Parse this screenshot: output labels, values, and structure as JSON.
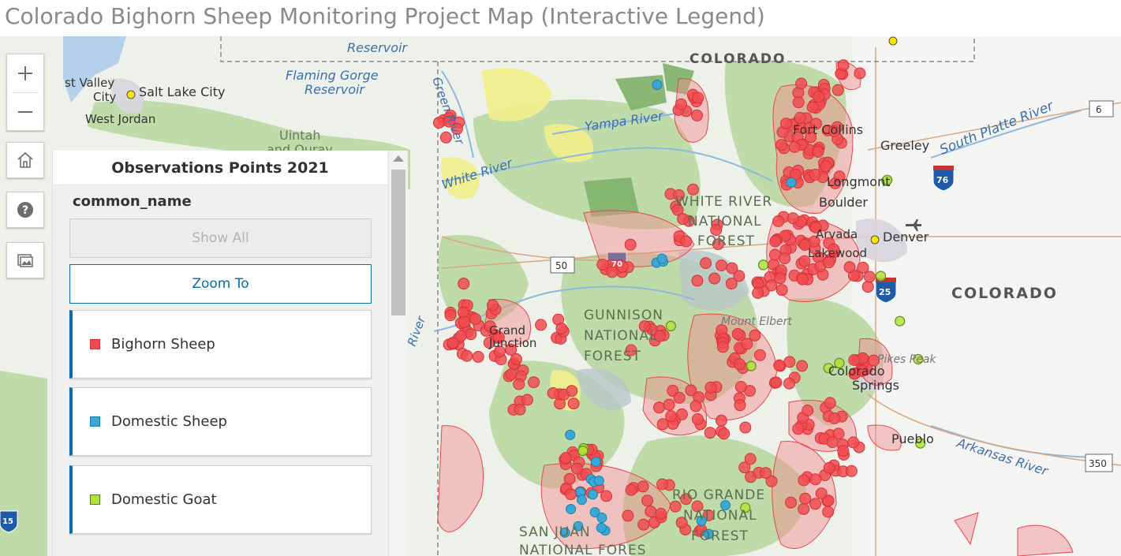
{
  "app": {
    "title": "Colorado Bighorn Sheep Monitoring Project Map (Interactive Legend)"
  },
  "map": {
    "labels": {
      "colorado_top": "COLORADO",
      "colorado_east": "COLORADO",
      "salt_lake_city": "Salt Lake City",
      "west_valley": "st Valley",
      "west_valley2": "City",
      "west_jordan": "West Jordan",
      "flaming_gorge": "Flaming Gorge",
      "reservoir": "Reservoir",
      "flaming_gorge_top": "Reservoir",
      "uintah": "Uintah",
      "and_ouray": "and Ouray",
      "green_river": "Green River",
      "yampa_river": "Yampa River",
      "white_river": "White River",
      "white_river_nf1": "WHITE RIVER",
      "white_river_nf2": "NATIONAL",
      "white_river_nf3": "FOREST",
      "gunnison1": "GUNNISON",
      "gunnison2": "NATIONAL",
      "gunnison3": "FOREST",
      "rio_grande1": "RIO GRANDE",
      "rio_grande2": "NATIONAL",
      "rio_grande3": "FOREST",
      "san_juan1": "SAN JUAN",
      "san_juan2": "NATIONAL FORES",
      "fort_collins": "Fort Collins",
      "greeley": "Greeley",
      "longmont": "Longmont",
      "boulder": "Boulder",
      "arvada": "Arvada",
      "lakewood": "Lakewood",
      "denver": "Denver",
      "colorado_springs1": "Colorado",
      "colorado_springs2": "Springs",
      "pikes_peak": "Pikes Peak",
      "mount_elbert": "Mount Elbert",
      "pueblo": "Pueblo",
      "south_platte": "South Platte River",
      "arkansas": "Arkansas River",
      "grand_junction1": "Grand",
      "grand_junction2": "Junction",
      "river_left": "River",
      "i76": "76",
      "i25": "25",
      "i70": "70",
      "i15": "15",
      "us6": "6",
      "us50": "50",
      "us350": "350"
    },
    "colors": {
      "bighorn": "#f0484d",
      "domestic_sheep": "#3aa7d4",
      "domestic_goat": "#b2e03d",
      "forest": "#b8d8a2",
      "water": "#b5d0ea"
    }
  },
  "controls": {
    "zoom_in": "zoom-in",
    "zoom_out": "zoom-out",
    "home": "home-icon",
    "help": "help-icon",
    "basemap": "basemap-icon"
  },
  "legend": {
    "title": "Observations Points 2021",
    "field": "common_name",
    "show_all": "Show All",
    "zoom_to": "Zoom To",
    "items": [
      {
        "label": "Bighorn Sheep",
        "color": "#f0484d"
      },
      {
        "label": "Domestic Sheep",
        "color": "#3aa7d4"
      },
      {
        "label": "Domestic Goat",
        "color": "#b2e03d"
      }
    ]
  }
}
